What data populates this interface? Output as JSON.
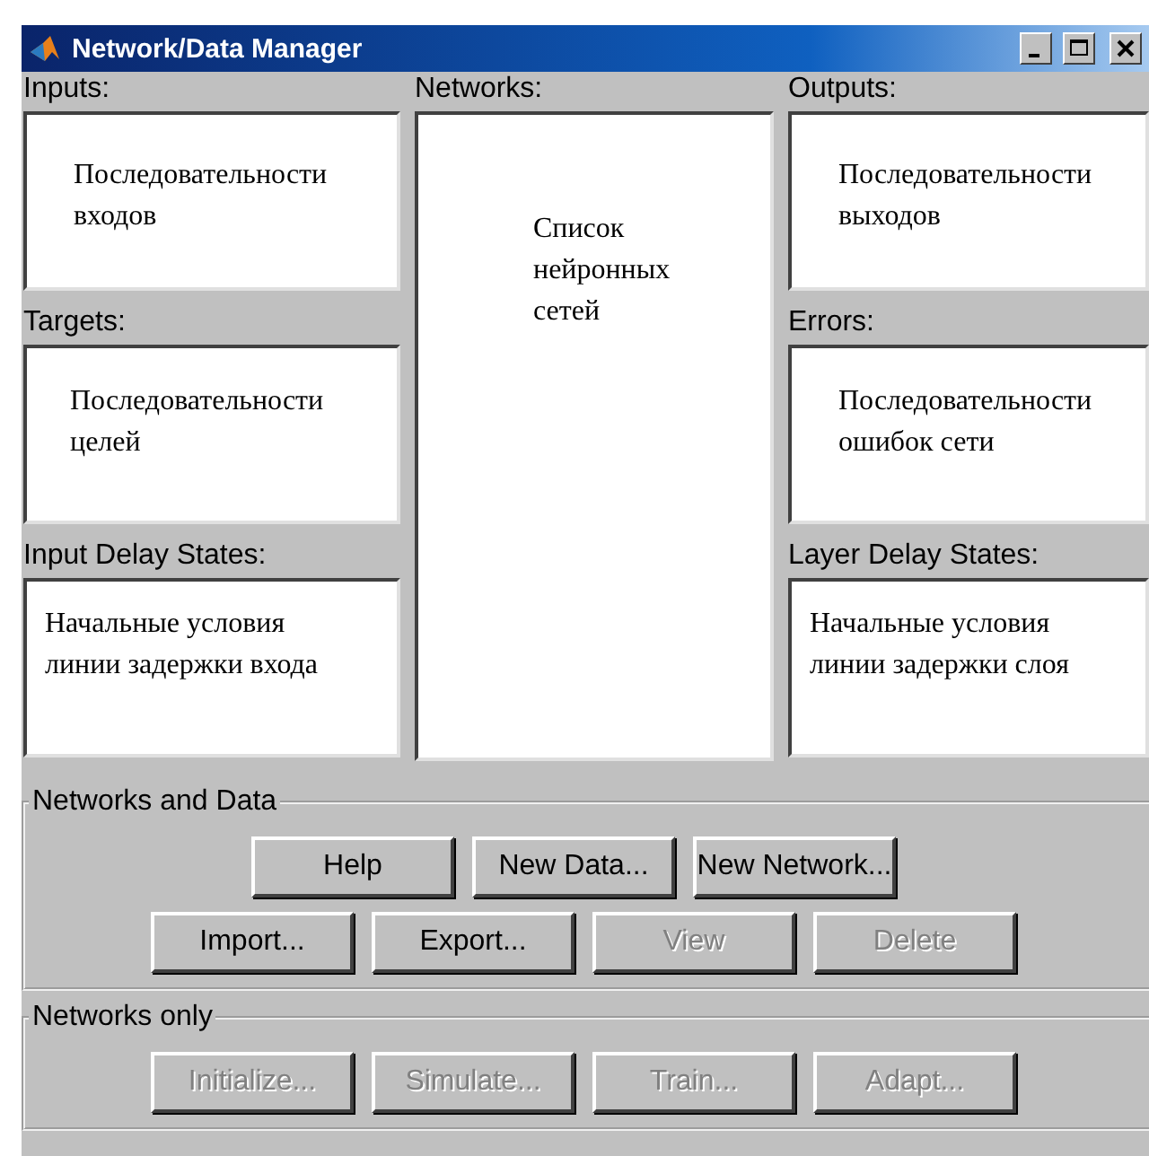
{
  "window": {
    "title": "Network/Data Manager"
  },
  "left_lists": [
    {
      "label": "Inputs:",
      "text": "Последовательности\nвходов"
    },
    {
      "label": "Targets:",
      "text": "Последовательности\nцелей"
    },
    {
      "label": "Input Delay States:",
      "text": "Начальные условия\nлинии задержки входа"
    }
  ],
  "center_list": {
    "label": "Networks:",
    "text": "Список\nнейронных\nсетей"
  },
  "right_lists": [
    {
      "label": "Outputs:",
      "text": "Последовательности\nвыходов"
    },
    {
      "label": "Errors:",
      "text": "Последовательности\nошибок сети"
    },
    {
      "label": "Layer Delay States:",
      "text": "Начальные условия\nлинии задержки слоя"
    }
  ],
  "groups": [
    {
      "title": "Networks and Data",
      "rows": [
        [
          {
            "label": "Help",
            "disabled": false
          },
          {
            "label": "New Data...",
            "disabled": false
          },
          {
            "label": "New Network...",
            "disabled": false
          }
        ],
        [
          {
            "label": "Import...",
            "disabled": false
          },
          {
            "label": "Export...",
            "disabled": false
          },
          {
            "label": "View",
            "disabled": true
          },
          {
            "label": "Delete",
            "disabled": true
          }
        ]
      ]
    },
    {
      "title": "Networks only",
      "rows": [
        [
          {
            "label": "Initialize...",
            "disabled": true
          },
          {
            "label": "Simulate...",
            "disabled": true
          },
          {
            "label": "Train...",
            "disabled": true
          },
          {
            "label": "Adapt...",
            "disabled": true
          }
        ]
      ]
    }
  ]
}
